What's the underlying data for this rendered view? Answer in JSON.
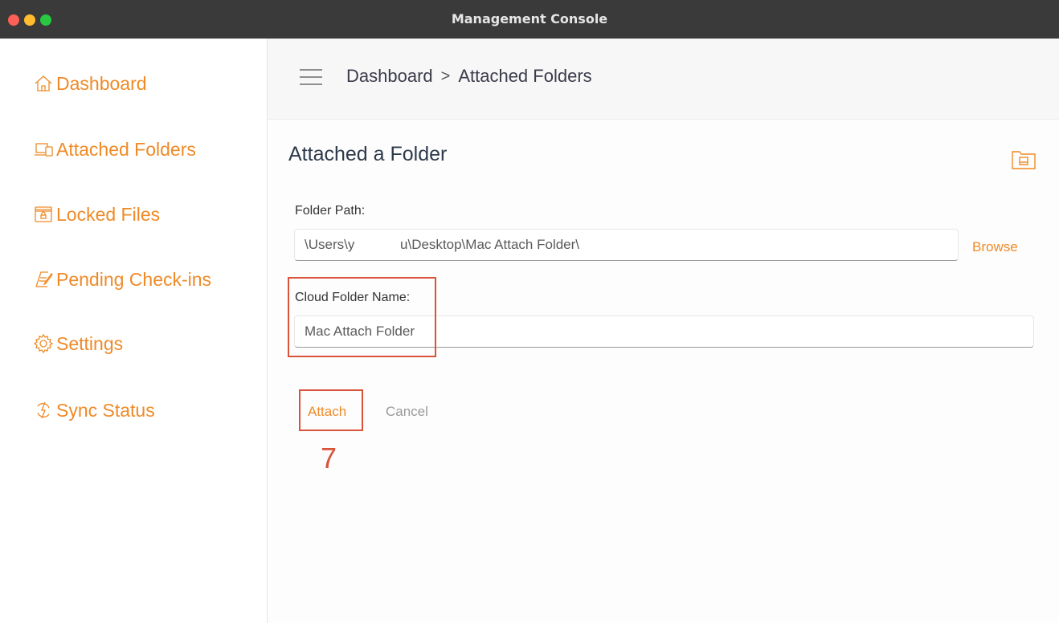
{
  "window": {
    "title": "Management Console"
  },
  "sidebar": {
    "items": [
      {
        "label": "Dashboard",
        "icon": "home-icon"
      },
      {
        "label": "Attached Folders",
        "icon": "devices-icon"
      },
      {
        "label": "Locked Files",
        "icon": "locked-window-icon"
      },
      {
        "label": "Pending Check-ins",
        "icon": "document-edit-icon"
      },
      {
        "label": "Settings",
        "icon": "gear-icon"
      },
      {
        "label": "Sync Status",
        "icon": "sync-icon"
      }
    ]
  },
  "header": {
    "breadcrumb": [
      "Dashboard",
      "Attached Folders"
    ],
    "separator": ">"
  },
  "form": {
    "title": "Attached a Folder",
    "folder_path_label": "Folder Path:",
    "folder_path_value": "\\Users\\y            u\\Desktop\\Mac Attach Folder\\",
    "browse_label": "Browse",
    "cloud_name_label": "Cloud Folder Name:",
    "cloud_name_value": "Mac Attach Folder",
    "attach_label": "Attach",
    "cancel_label": "Cancel"
  },
  "annotation": {
    "step": "7"
  },
  "colors": {
    "accent": "#ef8a27",
    "highlight": "#d9533b",
    "titlebar": "#3a3a3a"
  }
}
